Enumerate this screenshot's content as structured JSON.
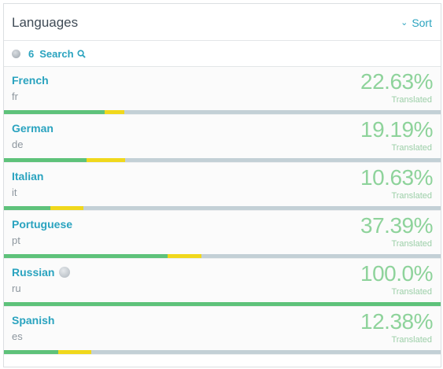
{
  "header": {
    "title": "Languages",
    "sort_label": "Sort"
  },
  "subbar": {
    "count": "6",
    "search_label": "Search"
  },
  "colors": {
    "accent": "#2aa3bf",
    "translated": "#8ed39b",
    "bar_green": "#5ec27a",
    "bar_yellow": "#f0d81c",
    "bar_bg": "#c3d0d6"
  },
  "languages": [
    {
      "name": "French",
      "code": "fr",
      "percent": "22.63%",
      "status": "Translated",
      "translated_frac": 0.23,
      "review_frac": 0.045,
      "source": false
    },
    {
      "name": "German",
      "code": "de",
      "percent": "19.19%",
      "status": "Translated",
      "translated_frac": 0.19,
      "review_frac": 0.087,
      "source": false
    },
    {
      "name": "Italian",
      "code": "it",
      "percent": "10.63%",
      "status": "Translated",
      "translated_frac": 0.106,
      "review_frac": 0.076,
      "source": false
    },
    {
      "name": "Portuguese",
      "code": "pt",
      "percent": "37.39%",
      "status": "Translated",
      "translated_frac": 0.374,
      "review_frac": 0.078,
      "source": false
    },
    {
      "name": "Russian",
      "code": "ru",
      "percent": "100.0%",
      "status": "Translated",
      "translated_frac": 1.0,
      "review_frac": 0,
      "source": true
    },
    {
      "name": "Spanish",
      "code": "es",
      "percent": "12.38%",
      "status": "Translated",
      "translated_frac": 0.124,
      "review_frac": 0.076,
      "source": false
    }
  ]
}
